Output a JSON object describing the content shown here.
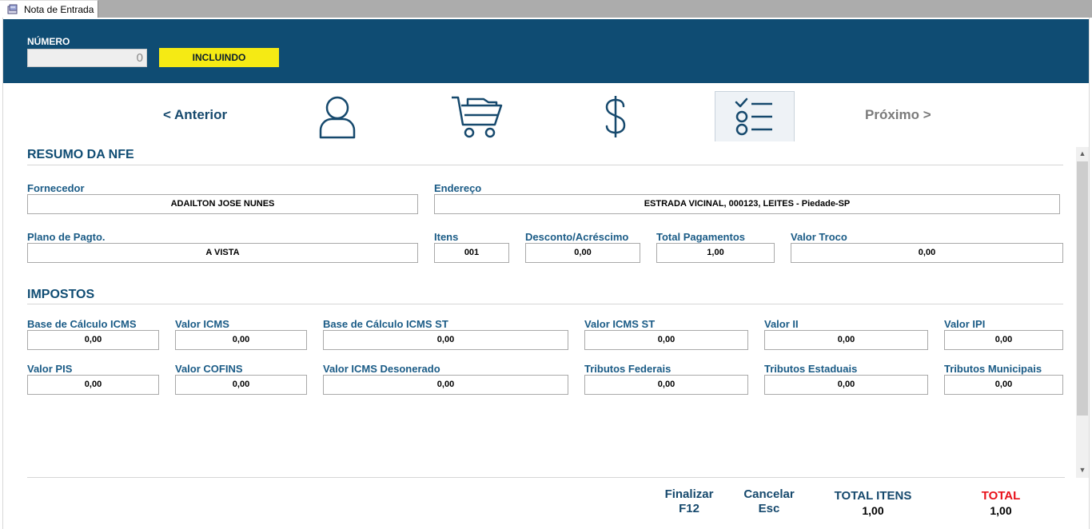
{
  "tab": {
    "title": "Nota de Entrada",
    "icon": "document-window-icon"
  },
  "header": {
    "number_label": "NÚMERO",
    "number_value": "0",
    "status": "INCLUINDO",
    "status_color": "#f5ea14",
    "bg_color": "#0f4c73"
  },
  "nav": {
    "prev": "< Anterior",
    "next": "Próximo >",
    "steps": [
      "person-icon",
      "shopping-cart-icon",
      "dollar-icon",
      "checklist-icon"
    ],
    "active_step": 4
  },
  "resumo": {
    "title": "RESUMO DA NFE",
    "fornecedor": {
      "label": "Fornecedor",
      "value": "ADAILTON JOSE NUNES"
    },
    "endereco": {
      "label": "Endereço",
      "value": "ESTRADA VICINAL, 000123, LEITES - Piedade-SP"
    },
    "plano": {
      "label": "Plano de Pagto.",
      "value": "A VISTA"
    },
    "itens": {
      "label": "Itens",
      "value": "001"
    },
    "desconto": {
      "label": "Desconto/Acréscimo",
      "value": "0,00"
    },
    "total_pagamentos": {
      "label": "Total Pagamentos",
      "value": "1,00"
    },
    "valor_troco": {
      "label": "Valor Troco",
      "value": "0,00"
    }
  },
  "impostos": {
    "title": "IMPOSTOS",
    "base_icms": {
      "label": "Base de Cálculo ICMS",
      "value": "0,00"
    },
    "valor_icms": {
      "label": "Valor ICMS",
      "value": "0,00"
    },
    "base_icms_st": {
      "label": "Base de Cálculo ICMS ST",
      "value": "0,00"
    },
    "valor_icms_st": {
      "label": "Valor ICMS ST",
      "value": "0,00"
    },
    "valor_ii": {
      "label": "Valor II",
      "value": "0,00"
    },
    "valor_ipi": {
      "label": "Valor IPI",
      "value": "0,00"
    },
    "valor_pis": {
      "label": "Valor PIS",
      "value": "0,00"
    },
    "valor_cofins": {
      "label": "Valor COFINS",
      "value": "0,00"
    },
    "icms_desonerado": {
      "label": "Valor ICMS Desonerado",
      "value": "0,00"
    },
    "tributos_federais": {
      "label": "Tributos Federais",
      "value": "0,00"
    },
    "tributos_estaduais": {
      "label": "Tributos Estaduais",
      "value": "0,00"
    },
    "tributos_municipais": {
      "label": "Tributos Municipais",
      "value": "0,00"
    }
  },
  "footer": {
    "finalizar": {
      "label": "Finalizar",
      "key": "F12"
    },
    "cancelar": {
      "label": "Cancelar",
      "key": "Esc"
    },
    "total_itens": {
      "label": "TOTAL ITENS",
      "value": "1,00"
    },
    "total": {
      "label": "TOTAL",
      "value": "1,00",
      "color": "#e8111a"
    }
  }
}
